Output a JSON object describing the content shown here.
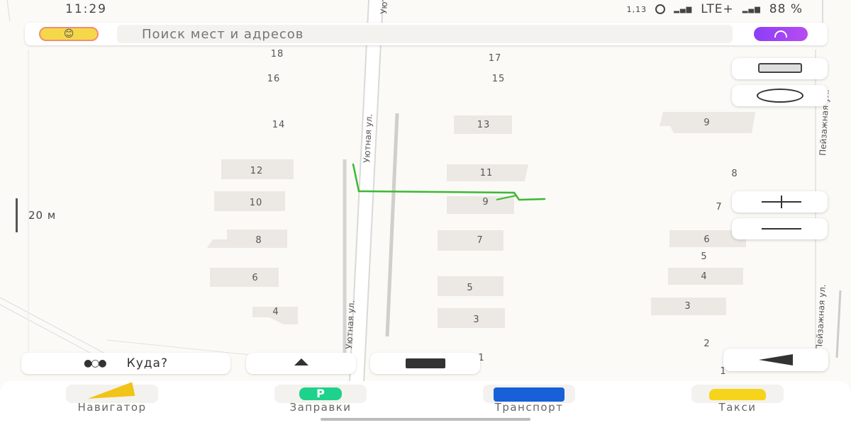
{
  "status_bar": {
    "time": "11:29",
    "data_rate": "1,13",
    "signal_top": "LTE+",
    "battery": "88 %"
  },
  "search": {
    "placeholder": "Поиск мест и адресов"
  },
  "map": {
    "street_labels": [
      "Уютная ул.",
      "Уютная ул.",
      "Пейзажная ул.",
      "Пейзажная ул.",
      "Уютная ул."
    ],
    "house_numbers_left": [
      "18",
      "16",
      "14",
      "12",
      "10",
      "8",
      "6",
      "4"
    ],
    "house_numbers_middle": [
      "17",
      "15",
      "13",
      "11",
      "9",
      "7",
      "5",
      "3",
      "1"
    ],
    "house_numbers_right": [
      "9",
      "8",
      "7",
      "6",
      "5",
      "4",
      "3",
      "2",
      "1"
    ],
    "scale_label": "20 м",
    "route_color": "#3cb832"
  },
  "chips": {
    "where_to": "Куда?"
  },
  "tabs": [
    {
      "label": "Навигатор"
    },
    {
      "label": "Заправки"
    },
    {
      "label": "Транспорт"
    },
    {
      "label": "Такси"
    }
  ]
}
